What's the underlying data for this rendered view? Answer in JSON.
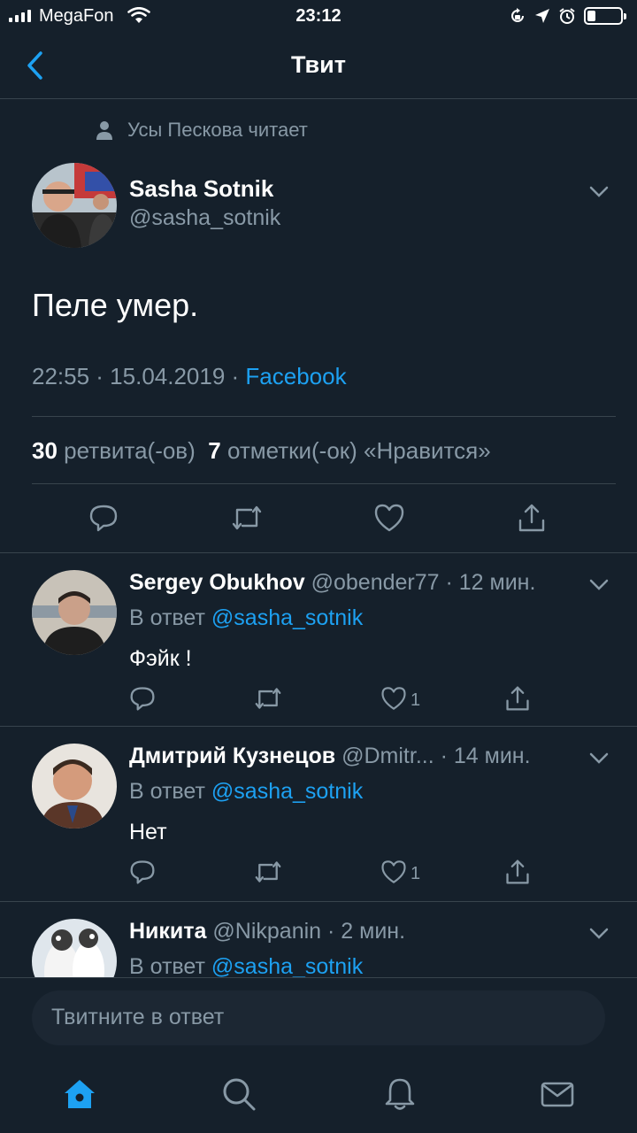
{
  "status_bar": {
    "carrier": "MegaFon",
    "time": "23:12",
    "battery_level": 0.25
  },
  "nav": {
    "title": "Твит"
  },
  "tweet": {
    "social_context": "Усы Пескова читает",
    "author_name": "Sasha Sotnik",
    "author_handle": "@sasha_sotnik",
    "text": "Пеле умер.",
    "meta_time": "22:55 · 15.04.2019 ·",
    "meta_source": "Facebook",
    "retweet_count": "30",
    "retweet_label": "ретвита(-ов)",
    "like_count": "7",
    "like_label": "отметки(-ок) «Нравится»"
  },
  "replies": [
    {
      "name": "Sergey Obukhov",
      "handle": "@obender77",
      "time": "12 мин.",
      "reply_to_prefix": "В ответ",
      "reply_to_handle": "@sasha_sotnik",
      "text": "Фэйк !",
      "likes": "1"
    },
    {
      "name": "Дмитрий Кузнецов",
      "handle": "@Dmitr...",
      "time": "14 мин.",
      "reply_to_prefix": "В ответ",
      "reply_to_handle": "@sasha_sotnik",
      "text": "Нет",
      "likes": "1"
    },
    {
      "name": "Никита",
      "handle": "@Nikpanin",
      "time": "2 мин.",
      "reply_to_prefix": "В ответ",
      "reply_to_handle": "@sasha_sotnik",
      "text": "",
      "likes": ""
    }
  ],
  "compose": {
    "placeholder": "Твитните в ответ"
  },
  "tabs": [
    "home-icon",
    "search-icon",
    "bell-icon",
    "mail-icon"
  ],
  "colors": {
    "background": "#15202b",
    "accent": "#1da1f2",
    "secondary_text": "#8899a6",
    "divider": "#38444d"
  }
}
